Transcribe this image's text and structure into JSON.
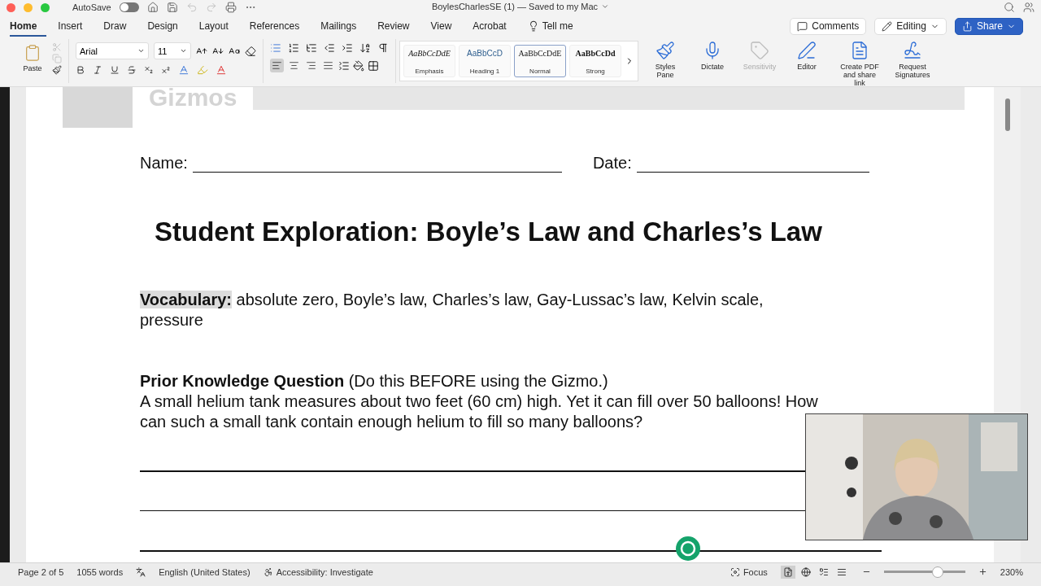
{
  "window": {
    "autosave_label": "AutoSave",
    "autosave_on": false,
    "title": "BoylesCharlesSE (1) — Saved to my Mac"
  },
  "ribbon_tabs": [
    {
      "label": "Home",
      "selected": true
    },
    {
      "label": "Insert",
      "selected": false
    },
    {
      "label": "Draw",
      "selected": false
    },
    {
      "label": "Design",
      "selected": false
    },
    {
      "label": "Layout",
      "selected": false
    },
    {
      "label": "References",
      "selected": false
    },
    {
      "label": "Mailings",
      "selected": false
    },
    {
      "label": "Review",
      "selected": false
    },
    {
      "label": "View",
      "selected": false
    },
    {
      "label": "Acrobat",
      "selected": false
    }
  ],
  "tell_me": "Tell me",
  "actions": [
    {
      "label": "Comments",
      "kind": "comments"
    },
    {
      "label": "Editing",
      "kind": "editing"
    },
    {
      "label": "Share",
      "kind": "share"
    }
  ],
  "paste_label": "Paste",
  "font": {
    "name": "Arial",
    "size": "11"
  },
  "alignment": [
    {
      "kind": "left",
      "selected": true
    },
    {
      "kind": "center",
      "selected": false
    },
    {
      "kind": "right",
      "selected": false
    },
    {
      "kind": "justify",
      "selected": false
    }
  ],
  "styles": [
    {
      "sample": "AaBbCcDdE",
      "label": "Emphasis",
      "kind": "emphasis",
      "selected": false
    },
    {
      "sample": "AaBbCcD",
      "label": "Heading 1",
      "kind": "heading",
      "selected": false
    },
    {
      "sample": "AaBbCcDdE",
      "label": "Normal",
      "kind": "normal",
      "selected": true
    },
    {
      "sample": "AaBbCcDd",
      "label": "Strong",
      "kind": "strong",
      "selected": false
    }
  ],
  "tools": [
    {
      "label": "Styles Pane",
      "kind": "styles",
      "disabled": false
    },
    {
      "label": "Dictate",
      "kind": "dictate",
      "disabled": false
    },
    {
      "label": "Sensitivity",
      "kind": "sensitivity",
      "disabled": true
    },
    {
      "label": "Editor",
      "kind": "editor",
      "disabled": false
    },
    {
      "label": "Create PDF and share link",
      "kind": "pdf",
      "disabled": false
    },
    {
      "label": "Request Signatures",
      "kind": "sign",
      "disabled": false
    }
  ],
  "document": {
    "header_logo": "Gizmos",
    "name_label": "Name:",
    "date_label": "Date:",
    "title": "Student Exploration: Boyle’s Law and Charles’s Law",
    "vocabulary_label": "Vocabulary:",
    "vocabulary_text": "absolute zero, Boyle’s law, Charles’s law, Gay-Lussac’s law, Kelvin scale, pressure",
    "prior_heading": "**Prior Knowledge Question** (Do this BEFORE using the Gizmo.)",
    "question": "A small helium tank measures about two feet (60 cm) high. Yet it can fill over 50 balloons! How can such a small tank contain enough helium to fill so many balloons?"
  },
  "status_bar": {
    "page": "Page 2 of 5",
    "words": "1055 words",
    "language": "English (United States)",
    "accessibility": "Accessibility: Investigate",
    "focus": "Focus",
    "views": [
      {
        "kind": "print",
        "selected": true
      },
      {
        "kind": "web",
        "selected": false
      },
      {
        "kind": "outline",
        "selected": false
      },
      {
        "kind": "draft",
        "selected": false
      }
    ],
    "zoom": {
      "level": 0.65,
      "reading": "230%"
    }
  }
}
